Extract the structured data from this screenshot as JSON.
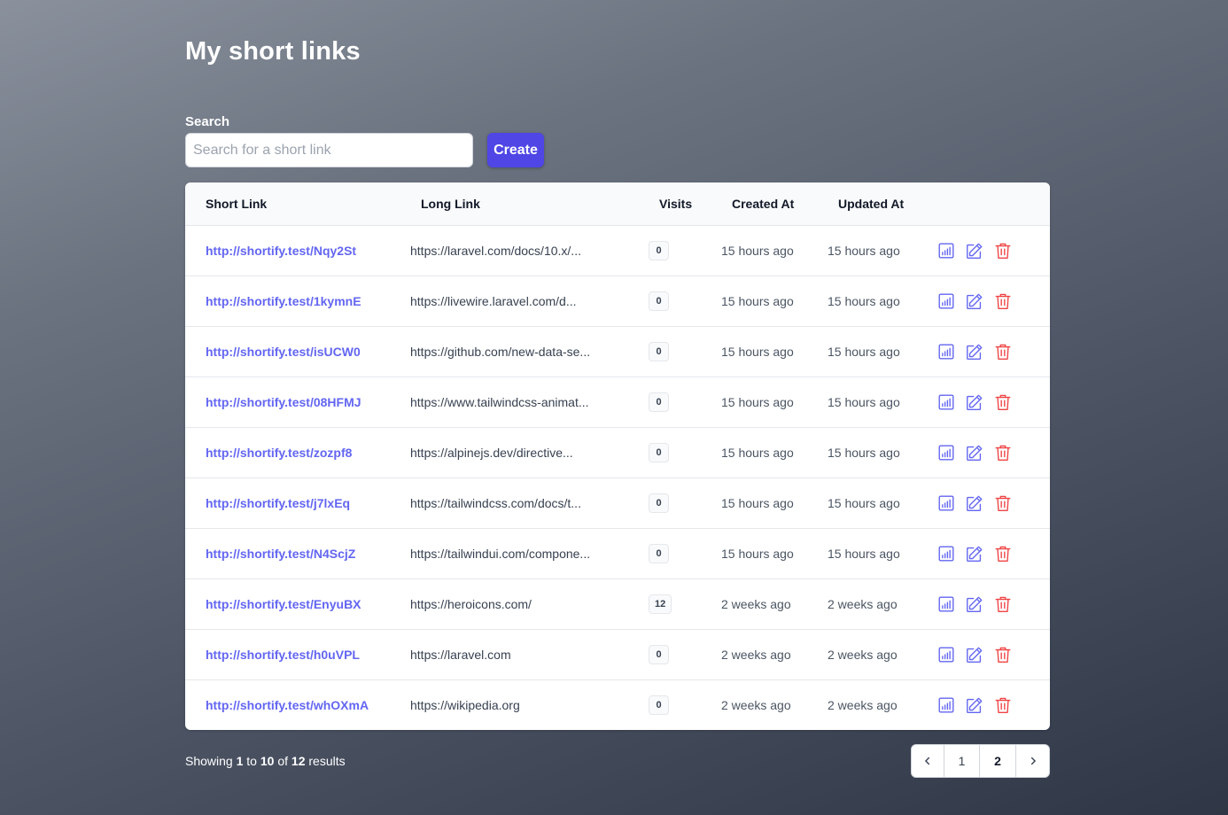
{
  "page": {
    "title": "My short links"
  },
  "search": {
    "label": "Search",
    "placeholder": "Search for a short link",
    "value": ""
  },
  "toolbar": {
    "create_label": "Create"
  },
  "table": {
    "headers": {
      "short_link": "Short Link",
      "long_link": "Long Link",
      "visits": "Visits",
      "created_at": "Created At",
      "updated_at": "Updated At"
    },
    "rows": [
      {
        "short_link": "http://shortify.test/Nqy2St",
        "long_link": "https://laravel.com/docs/10.x/...",
        "visits": "0",
        "created_at": "15 hours ago",
        "updated_at": "15 hours ago"
      },
      {
        "short_link": "http://shortify.test/1kymnE",
        "long_link": "https://livewire.laravel.com/d...",
        "visits": "0",
        "created_at": "15 hours ago",
        "updated_at": "15 hours ago"
      },
      {
        "short_link": "http://shortify.test/isUCW0",
        "long_link": "https://github.com/new-data-se...",
        "visits": "0",
        "created_at": "15 hours ago",
        "updated_at": "15 hours ago"
      },
      {
        "short_link": "http://shortify.test/08HFMJ",
        "long_link": "https://www.tailwindcss-animat...",
        "visits": "0",
        "created_at": "15 hours ago",
        "updated_at": "15 hours ago"
      },
      {
        "short_link": "http://shortify.test/zozpf8",
        "long_link": "https://alpinejs.dev/directive...",
        "visits": "0",
        "created_at": "15 hours ago",
        "updated_at": "15 hours ago"
      },
      {
        "short_link": "http://shortify.test/j7lxEq",
        "long_link": "https://tailwindcss.com/docs/t...",
        "visits": "0",
        "created_at": "15 hours ago",
        "updated_at": "15 hours ago"
      },
      {
        "short_link": "http://shortify.test/N4ScjZ",
        "long_link": "https://tailwindui.com/compone...",
        "visits": "0",
        "created_at": "15 hours ago",
        "updated_at": "15 hours ago"
      },
      {
        "short_link": "http://shortify.test/EnyuBX",
        "long_link": "https://heroicons.com/",
        "visits": "12",
        "created_at": "2 weeks ago",
        "updated_at": "2 weeks ago"
      },
      {
        "short_link": "http://shortify.test/h0uVPL",
        "long_link": "https://laravel.com",
        "visits": "0",
        "created_at": "2 weeks ago",
        "updated_at": "2 weeks ago"
      },
      {
        "short_link": "http://shortify.test/whOXmA",
        "long_link": "https://wikipedia.org",
        "visits": "0",
        "created_at": "2 weeks ago",
        "updated_at": "2 weeks ago"
      }
    ],
    "row_actions": [
      "stats-icon",
      "edit-icon",
      "trash-icon"
    ]
  },
  "footer": {
    "showing_prefix": "Showing",
    "from": "1",
    "to_word": "to",
    "to": "10",
    "of_word": "of",
    "total": "12",
    "results_word": "results"
  },
  "pagination": {
    "prev_icon": "chevron-left-icon",
    "pages": [
      "1",
      "2"
    ],
    "current": "2",
    "next_icon": "chevron-right-icon"
  },
  "colors": {
    "accent": "#4f46e5",
    "link": "#6366f1",
    "action_icon": "#6366f1",
    "delete_icon": "#ef4444"
  }
}
